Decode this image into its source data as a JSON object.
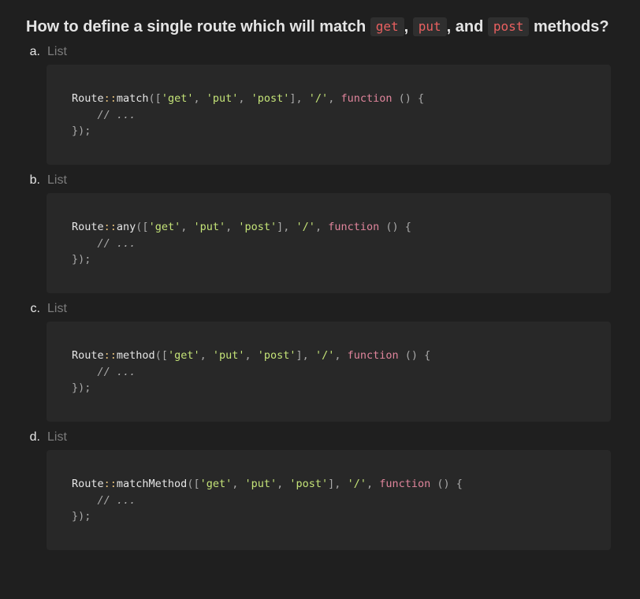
{
  "question": {
    "prefix": "How to define a single route which will match",
    "code1": "get",
    "sep1": ",",
    "code2": "put",
    "sep2": ", and",
    "code3": "post",
    "suffix": "methods?"
  },
  "options": [
    {
      "letter": "a.",
      "type_label": "List",
      "code": {
        "class_name": "Route",
        "operator": "::",
        "method": "match",
        "open": "([",
        "str1": "'get'",
        "comma1": ", ",
        "str2": "'put'",
        "comma2": ", ",
        "str3": "'post'",
        "close_arr": "], ",
        "str4": "'/'",
        "comma3": ", ",
        "keyword": "function",
        "tail": " () {",
        "comment": "    // ...",
        "closing": "});"
      }
    },
    {
      "letter": "b.",
      "type_label": "List",
      "code": {
        "class_name": "Route",
        "operator": "::",
        "method": "any",
        "open": "([",
        "str1": "'get'",
        "comma1": ", ",
        "str2": "'put'",
        "comma2": ", ",
        "str3": "'post'",
        "close_arr": "], ",
        "str4": "'/'",
        "comma3": ", ",
        "keyword": "function",
        "tail": " () {",
        "comment": "    // ...",
        "closing": "});"
      }
    },
    {
      "letter": "c.",
      "type_label": "List",
      "code": {
        "class_name": "Route",
        "operator": "::",
        "method": "method",
        "open": "([",
        "str1": "'get'",
        "comma1": ", ",
        "str2": "'put'",
        "comma2": ", ",
        "str3": "'post'",
        "close_arr": "], ",
        "str4": "'/'",
        "comma3": ", ",
        "keyword": "function",
        "tail": " () {",
        "comment": "    // ...",
        "closing": "});"
      }
    },
    {
      "letter": "d.",
      "type_label": "List",
      "code": {
        "class_name": "Route",
        "operator": "::",
        "method": "matchMethod",
        "open": "([",
        "str1": "'get'",
        "comma1": ", ",
        "str2": "'put'",
        "comma2": ", ",
        "str3": "'post'",
        "close_arr": "], ",
        "str4": "'/'",
        "comma3": ", ",
        "keyword": "function",
        "tail": " () {",
        "comment": "    // ...",
        "closing": "});"
      }
    }
  ],
  "colors": {
    "background": "#1f1f1f",
    "code_background": "#282828",
    "inline_code": "#ea6060",
    "string": "#c5e478",
    "keyword": "#e0859c",
    "operator": "#e5c07b"
  }
}
